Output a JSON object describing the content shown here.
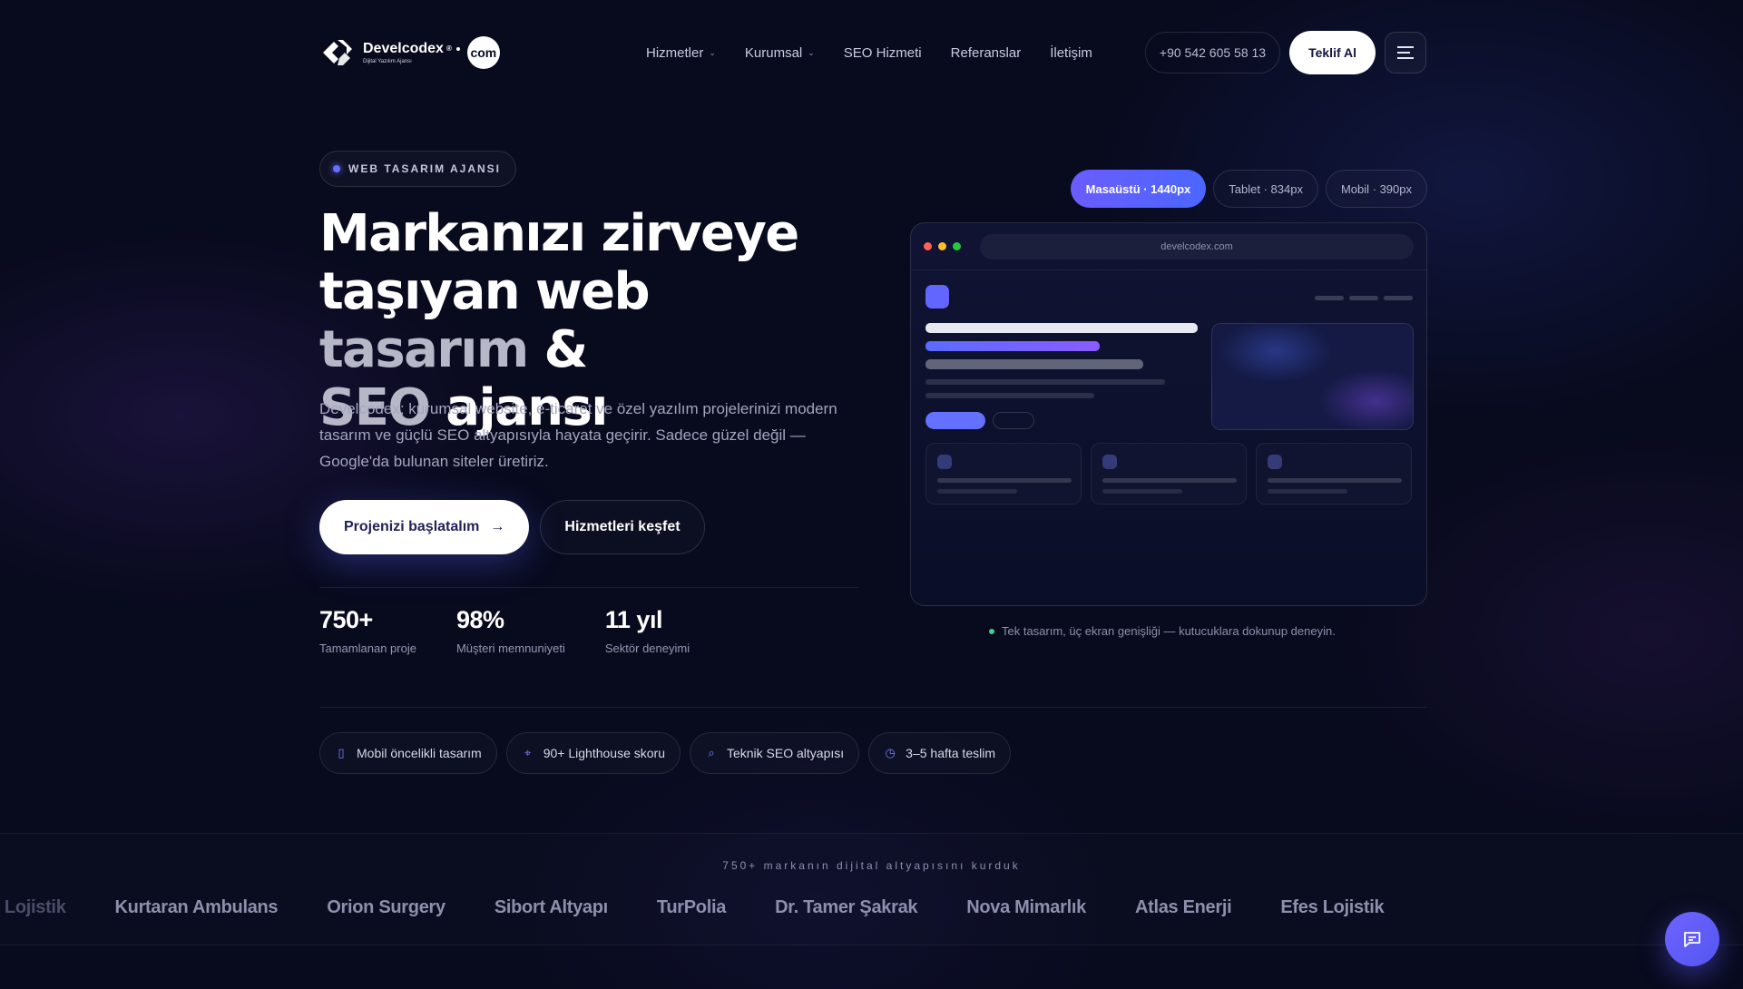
{
  "brand": {
    "name": "Develcodex",
    "reg": "®",
    "tagline": "Dijital Yazılım Ajansı",
    "tld": "com"
  },
  "nav": {
    "items": [
      {
        "label": "Hizmetler",
        "dropdown": true
      },
      {
        "label": "Kurumsal",
        "dropdown": true
      },
      {
        "label": "SEO Hizmeti",
        "dropdown": false
      },
      {
        "label": "Referanslar",
        "dropdown": false
      },
      {
        "label": "İletişim",
        "dropdown": false
      }
    ],
    "phone": "+90 542 605 58 13",
    "quote_label": "Teklif Al",
    "menu_icon": "hamburger-icon"
  },
  "hero": {
    "badge": "WEB TASARIM AJANSI",
    "title_line1": "Markanızı zirveye",
    "title_line2_a": "taşıyan web ",
    "title_line2_b": "tasarım",
    "title_line2_c": " &",
    "title_line3_a": "SEO",
    "title_line3_b": " ajansı",
    "description": "Develcodex; kurumsal website, e-ticaret ve özel yazılım projelerinizi modern tasarım ve güçlü SEO altyapısıyla hayata geçirir. Sadece güzel değil — Google'da bulunan siteler üretiriz.",
    "cta_primary": "Projenizi başlatalım",
    "cta_primary_icon": "→",
    "cta_secondary": "Hizmetleri keşfet"
  },
  "stats": [
    {
      "value": "750+",
      "label": "Tamamlanan proje"
    },
    {
      "value": "98%",
      "label": "Müşteri memnuniyeti"
    },
    {
      "value": "11 yıl",
      "label": "Sektör deneyimi"
    }
  ],
  "preview": {
    "tabs": [
      {
        "label": "Masaüstü · 1440px",
        "active": true
      },
      {
        "label": "Tablet · 834px",
        "active": false
      },
      {
        "label": "Mobil · 390px",
        "active": false
      }
    ],
    "url": "develcodex.com",
    "hint": "Tek tasarım, üç ekran genişliği — kutucuklara dokunup deneyin."
  },
  "features": [
    {
      "label": "Mobil öncelikli tasarım",
      "icon": "phone-icon",
      "glyph": "▯"
    },
    {
      "label": "90+ Lighthouse skoru",
      "icon": "crosshair-icon",
      "glyph": "⌖"
    },
    {
      "label": "Teknik SEO altyapısı",
      "icon": "search-icon",
      "glyph": "⌕"
    },
    {
      "label": "3–5 hafta teslim",
      "icon": "clock-icon",
      "glyph": "◷"
    }
  ],
  "brands_strip": {
    "title": "750+ markanın dijital altyapısını kurduk",
    "brands": [
      "es Lojistik",
      "Kurtaran Ambulans",
      "Orion Surgery",
      "Sibort Altyapı",
      "TurPolia",
      "Dr. Tamer Şakrak",
      "Nova Mimarlık",
      "Atlas Enerji",
      "Efes Lojistik"
    ]
  },
  "colors": {
    "background": "#080a1d",
    "accent": "#6470ff",
    "accent_gradient_end": "#4b66ff",
    "success_dot": "#3fcf8e"
  }
}
